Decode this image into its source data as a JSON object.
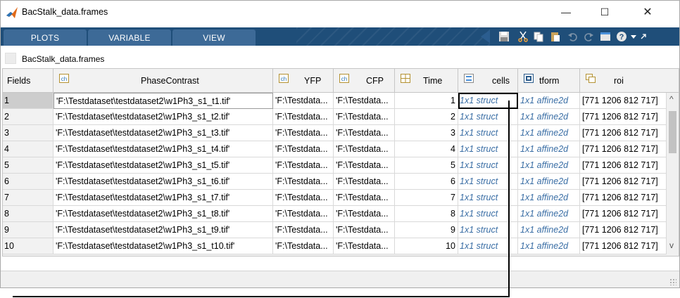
{
  "window": {
    "title": "BacStalk_data.frames",
    "minimize": "—",
    "maximize": "☐",
    "close": "✕"
  },
  "toolstrip": {
    "tabs": [
      "PLOTS",
      "VARIABLE",
      "VIEW"
    ],
    "icons": [
      "save-icon",
      "cut-icon",
      "copy-icon",
      "paste-icon",
      "undo-icon",
      "redo-icon",
      "layout-icon",
      "help-icon",
      "dropdown-icon",
      "collapse-icon"
    ]
  },
  "breadcrumb": {
    "label": "BacStalk_data.frames"
  },
  "table": {
    "columns": [
      {
        "key": "fields",
        "label": "Fields",
        "icon": ""
      },
      {
        "key": "PhaseContrast",
        "label": "PhaseContrast",
        "icon": "char-array-icon"
      },
      {
        "key": "YFP",
        "label": "YFP",
        "icon": "char-array-icon"
      },
      {
        "key": "CFP",
        "label": "CFP",
        "icon": "char-array-icon"
      },
      {
        "key": "Time",
        "label": "Time",
        "icon": "numeric-grid-icon"
      },
      {
        "key": "cells",
        "label": "cells",
        "icon": "struct-icon"
      },
      {
        "key": "tform",
        "label": "tform",
        "icon": "object-icon"
      },
      {
        "key": "roi",
        "label": "roi",
        "icon": "matrix-icon"
      }
    ],
    "rows": [
      [
        "1",
        "'F:\\Testdataset\\testdataset2\\w1Ph3_s1_t1.tif'",
        "'F:\\Testdata...",
        "'F:\\Testdata...",
        "1",
        "1x1 struct",
        "1x1 affine2d",
        "[771 1206 812 717]"
      ],
      [
        "2",
        "'F:\\Testdataset\\testdataset2\\w1Ph3_s1_t2.tif'",
        "'F:\\Testdata...",
        "'F:\\Testdata...",
        "2",
        "1x1 struct",
        "1x1 affine2d",
        "[771 1206 812 717]"
      ],
      [
        "3",
        "'F:\\Testdataset\\testdataset2\\w1Ph3_s1_t3.tif'",
        "'F:\\Testdata...",
        "'F:\\Testdata...",
        "3",
        "1x1 struct",
        "1x1 affine2d",
        "[771 1206 812 717]"
      ],
      [
        "4",
        "'F:\\Testdataset\\testdataset2\\w1Ph3_s1_t4.tif'",
        "'F:\\Testdata...",
        "'F:\\Testdata...",
        "4",
        "1x1 struct",
        "1x1 affine2d",
        "[771 1206 812 717]"
      ],
      [
        "5",
        "'F:\\Testdataset\\testdataset2\\w1Ph3_s1_t5.tif'",
        "'F:\\Testdata...",
        "'F:\\Testdata...",
        "5",
        "1x1 struct",
        "1x1 affine2d",
        "[771 1206 812 717]"
      ],
      [
        "6",
        "'F:\\Testdataset\\testdataset2\\w1Ph3_s1_t6.tif'",
        "'F:\\Testdata...",
        "'F:\\Testdata...",
        "6",
        "1x1 struct",
        "1x1 affine2d",
        "[771 1206 812 717]"
      ],
      [
        "7",
        "'F:\\Testdataset\\testdataset2\\w1Ph3_s1_t7.tif'",
        "'F:\\Testdata...",
        "'F:\\Testdata...",
        "7",
        "1x1 struct",
        "1x1 affine2d",
        "[771 1206 812 717]"
      ],
      [
        "8",
        "'F:\\Testdataset\\testdataset2\\w1Ph3_s1_t8.tif'",
        "'F:\\Testdata...",
        "'F:\\Testdata...",
        "8",
        "1x1 struct",
        "1x1 affine2d",
        "[771 1206 812 717]"
      ],
      [
        "9",
        "'F:\\Testdataset\\testdataset2\\w1Ph3_s1_t9.tif'",
        "'F:\\Testdata...",
        "'F:\\Testdata...",
        "9",
        "1x1 struct",
        "1x1 affine2d",
        "[771 1206 812 717]"
      ],
      [
        "10",
        "'F:\\Testdataset\\testdataset2\\w1Ph3_s1_t10.tif'",
        "'F:\\Testdata...",
        "'F:\\Testdata...",
        "10",
        "1x1 struct",
        "1x1 affine2d",
        "[771 1206 812 717]"
      ]
    ],
    "selected_row": "1",
    "selected_cell": "cells"
  },
  "scroll": {
    "left": "<",
    "right": ">",
    "up": "^",
    "down": "v"
  },
  "colors": {
    "toolstrip": "#1f4e79",
    "tab": "#3d6a97",
    "object_text": "#3a6ea5",
    "header_bg": "#f2f2f2"
  }
}
